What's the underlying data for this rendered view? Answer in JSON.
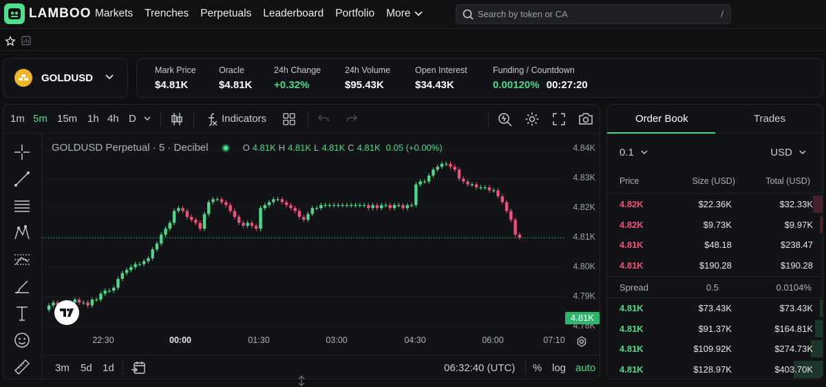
{
  "brand": {
    "name": "LAMBOO",
    "accent": "#4ee08a"
  },
  "nav": {
    "items": [
      "Markets",
      "Trenches",
      "Perpetuals",
      "Leaderboard",
      "Portfolio"
    ],
    "more_label": "More"
  },
  "search": {
    "placeholder": "Search by token or CA",
    "shortcut": "/"
  },
  "market": {
    "symbol": "GOLDUSD"
  },
  "stats": {
    "mark_price": {
      "label": "Mark Price",
      "value": "$4.81K"
    },
    "oracle": {
      "label": "Oracle",
      "value": "$4.81K"
    },
    "change_24h": {
      "label": "24h Change",
      "value": "+0.32%"
    },
    "volume_24h": {
      "label": "24h Volume",
      "value": "$95.43K"
    },
    "open_interest": {
      "label": "Open Interest",
      "value": "$34.43K"
    },
    "funding": {
      "label": "Funding / Countdown",
      "rate": "0.00120%",
      "countdown": "00:27:20"
    }
  },
  "toolbar": {
    "intervals": [
      "1m",
      "5m",
      "15m",
      "1h",
      "4h",
      "D"
    ],
    "active_interval": "5m",
    "indicators_label": "Indicators"
  },
  "legend": {
    "title": "GOLDUSD Perpetual · 5 · Decibel",
    "o_label": "O",
    "o_value": "4.81K",
    "h_label": "H",
    "h_value": "4.81K",
    "l_label": "L",
    "l_value": "4.81K",
    "c_label": "C",
    "c_value": "4.81K",
    "change": "0.05 (+0.00%)"
  },
  "chart_data": {
    "type": "candlestick",
    "ylim": [
      4.775,
      4.845
    ],
    "y_ticks": [
      "4.84K",
      "4.83K",
      "4.82K",
      "4.81K",
      "4.80K",
      "4.79K",
      "4.78K"
    ],
    "y_tick_values": [
      4.84,
      4.83,
      4.82,
      4.81,
      4.8,
      4.79,
      4.78
    ],
    "x_ticks": [
      "22:30",
      "00:00",
      "01:30",
      "03:00",
      "04:30",
      "06:00",
      "07:10"
    ],
    "x_tick_bold": [
      false,
      true,
      false,
      false,
      false,
      false,
      false
    ],
    "last_price_label": "4.81K",
    "last_price": 4.8099,
    "closes": [
      4.787,
      4.788,
      4.787,
      4.786,
      4.788,
      4.788,
      4.789,
      4.788,
      4.788,
      4.787,
      4.789,
      4.789,
      4.791,
      4.792,
      4.792,
      4.793,
      4.796,
      4.798,
      4.799,
      4.8,
      4.801,
      4.801,
      4.802,
      4.803,
      4.806,
      4.808,
      4.811,
      4.813,
      4.815,
      4.819,
      4.82,
      4.819,
      4.817,
      4.816,
      4.815,
      4.813,
      4.818,
      4.822,
      4.823,
      4.823,
      4.822,
      4.821,
      4.819,
      4.817,
      4.815,
      4.814,
      4.815,
      4.814,
      4.813,
      4.82,
      4.821,
      4.822,
      4.823,
      4.823,
      4.822,
      4.821,
      4.82,
      4.819,
      4.817,
      4.816,
      4.818,
      4.82,
      4.82,
      4.821,
      4.821,
      4.821,
      4.821,
      4.821,
      4.821,
      4.821,
      4.821,
      4.821,
      4.821,
      4.821,
      4.82,
      4.821,
      4.82,
      4.821,
      4.821,
      4.82,
      4.821,
      4.821,
      4.82,
      4.821,
      4.821,
      4.828,
      4.829,
      4.829,
      4.831,
      4.833,
      4.834,
      4.835,
      4.835,
      4.834,
      4.833,
      4.83,
      4.829,
      4.828,
      4.828,
      4.827,
      4.827,
      4.827,
      4.826,
      4.826,
      4.824,
      4.822,
      4.819,
      4.816,
      4.811,
      4.81
    ]
  },
  "bottombar": {
    "ranges": [
      "3m",
      "5d",
      "1d"
    ],
    "clock": "06:32:40 (UTC)",
    "pct": "%",
    "log": "log",
    "auto": "auto"
  },
  "orderbook": {
    "tabs": [
      "Order Book",
      "Trades"
    ],
    "tick_size": "0.1",
    "currency": "USD",
    "headers": {
      "price": "Price",
      "size": "Size (USD)",
      "total": "Total (USD)"
    },
    "asks": [
      {
        "price": "4.82K",
        "size": "$22.36K",
        "total": "$32.33K",
        "depth": 0.05
      },
      {
        "price": "4.82K",
        "size": "$9.73K",
        "total": "$9.97K",
        "depth": 0.02
      },
      {
        "price": "4.81K",
        "size": "$48.18",
        "total": "$238.47",
        "depth": 0.0
      },
      {
        "price": "4.81K",
        "size": "$190.28",
        "total": "$190.28",
        "depth": 0.0
      }
    ],
    "spread": {
      "label": "Spread",
      "value": "0.5",
      "pct": "0.0104%"
    },
    "bids": [
      {
        "price": "4.81K",
        "size": "$73.43K",
        "total": "$73.43K",
        "depth": 0.02
      },
      {
        "price": "4.81K",
        "size": "$91.37K",
        "total": "$164.81K",
        "depth": 0.04
      },
      {
        "price": "4.81K",
        "size": "$109.92K",
        "total": "$274.73K",
        "depth": 0.06
      },
      {
        "price": "4.81K",
        "size": "$128.97K",
        "total": "$403.70K",
        "depth": 0.14
      }
    ],
    "ask_color": "#f0517a",
    "bid_color": "#4cd98a"
  }
}
